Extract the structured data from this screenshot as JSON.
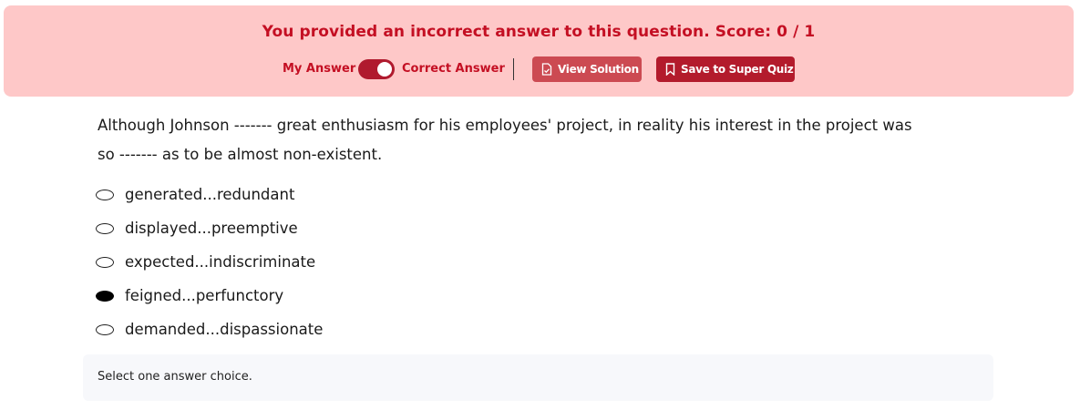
{
  "banner": {
    "title": "You provided an incorrect answer to this question. Score: 0 / 1",
    "my_answer_label": "My Answer",
    "correct_answer_label": "Correct Answer",
    "toggle_state": "on",
    "view_solution_label": "View Solution",
    "save_label": "Save to Super Quiz",
    "background_color": "#fec8c8",
    "text_color": "#c40f23"
  },
  "question": {
    "line1": "Although Johnson ------- great enthusiasm for his employees' project, in reality his interest in the project was",
    "line2": "so ------- as to be almost non-existent."
  },
  "choices": [
    {
      "label": "generated...redundant",
      "selected": false
    },
    {
      "label": "displayed...preemptive",
      "selected": false
    },
    {
      "label": "expected...indiscriminate",
      "selected": false
    },
    {
      "label": "feigned...perfunctory",
      "selected": true
    },
    {
      "label": "demanded...dispassionate",
      "selected": false
    }
  ],
  "hint": "Select one answer choice."
}
